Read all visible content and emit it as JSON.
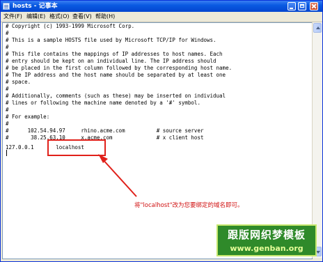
{
  "window": {
    "title": "hosts - 记事本"
  },
  "menu": [
    "文件(F)",
    "编辑(E)",
    "格式(O)",
    "查看(V)",
    "帮助(H)"
  ],
  "lines": [
    "# Copyright (c) 1993-1999 Microsoft Corp.",
    "#",
    "# This is a sample HOSTS file used by Microsoft TCP/IP for Windows.",
    "#",
    "# This file contains the mappings of IP addresses to host names. Each",
    "# entry should be kept on an individual line. The IP address should",
    "# be placed in the first column followed by the corresponding host name.",
    "# The IP address and the host name should be separated by at least one",
    "# space.",
    "#",
    "# Additionally, comments (such as these) may be inserted on individual",
    "# lines or following the machine name denoted by a '#' symbol.",
    "#",
    "# For example:",
    "#",
    "#      102.54.94.97     rhino.acme.com          # source server",
    "#       38.25.63.10     x.acme.com              # x client host",
    "",
    "127.0.0.1       localhost"
  ],
  "annotation": "将\"localhost\"改为您要绑定的域名即可。",
  "watermark": {
    "title": "跟版网织梦模板",
    "url": "www.genban.org"
  },
  "colors": {
    "annotation": "#e0201a",
    "watermark_bg": "#2f8a2a"
  }
}
